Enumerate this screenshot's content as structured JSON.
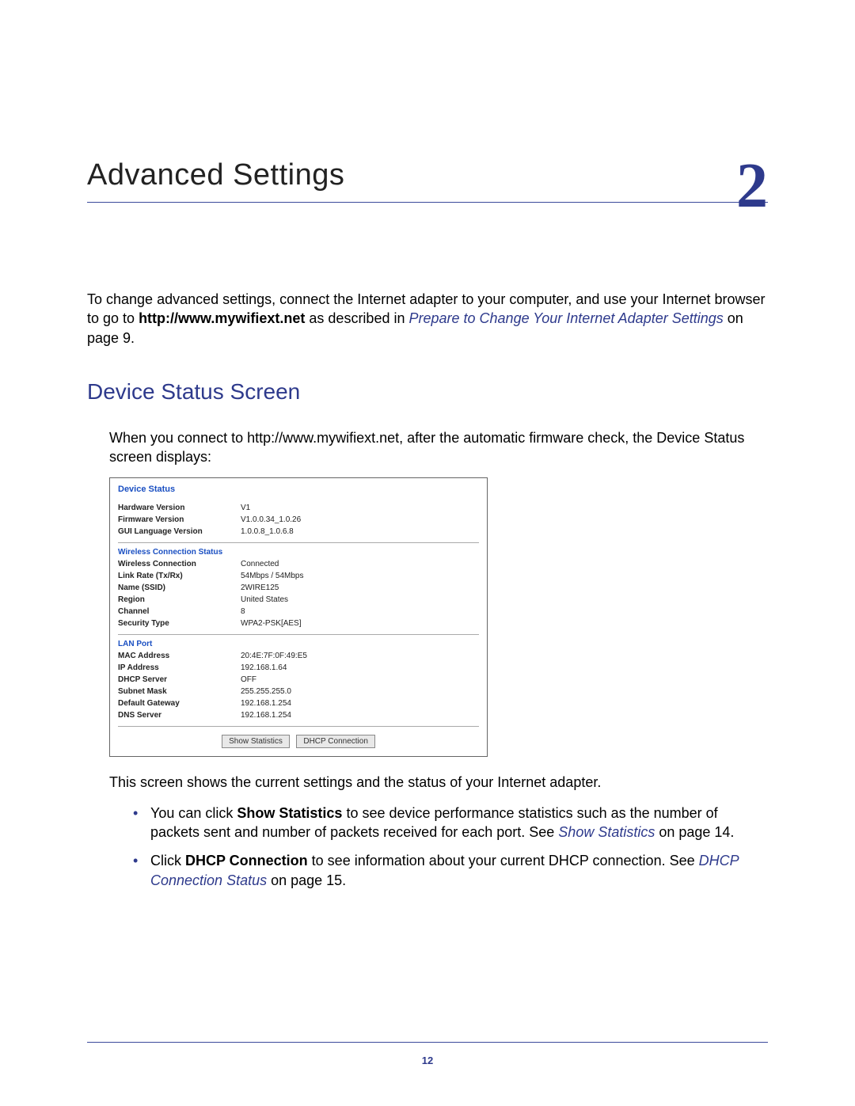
{
  "chapter": {
    "title": "Advanced Settings",
    "number": "2"
  },
  "intro": {
    "pre": "To change advanced settings, connect the Internet adapter to your computer, and use your Internet browser to go to ",
    "bold_url": "http://www.mywifiext.net",
    "mid": " as described in ",
    "link": "Prepare to Change Your Internet Adapter Settings",
    "post": " on page 9."
  },
  "section_heading": "Device Status Screen",
  "para_connect": "When you connect to http://www.mywifiext.net, after the automatic firmware check, the Device Status screen displays:",
  "device_status": {
    "title": "Device Status",
    "general": [
      {
        "label": "Hardware Version",
        "value": "V1"
      },
      {
        "label": "Firmware Version",
        "value": "V1.0.0.34_1.0.26"
      },
      {
        "label": "GUI Language Version",
        "value": "1.0.0.8_1.0.6.8"
      }
    ],
    "wireless_title": "Wireless Connection Status",
    "wireless": [
      {
        "label": "Wireless Connection",
        "value": "Connected"
      },
      {
        "label": "Link Rate (Tx/Rx)",
        "value": "54Mbps / 54Mbps"
      },
      {
        "label": "Name (SSID)",
        "value": "2WIRE125"
      },
      {
        "label": "Region",
        "value": "United States"
      },
      {
        "label": "Channel",
        "value": "8"
      },
      {
        "label": "Security Type",
        "value": "WPA2-PSK[AES]"
      }
    ],
    "lan_title": "LAN Port",
    "lan": [
      {
        "label": "MAC Address",
        "value": "20:4E:7F:0F:49:E5"
      },
      {
        "label": "IP Address",
        "value": "192.168.1.64"
      },
      {
        "label": "DHCP Server",
        "value": "OFF"
      },
      {
        "label": "Subnet Mask",
        "value": "255.255.255.0"
      },
      {
        "label": "Default Gateway",
        "value": "192.168.1.254"
      },
      {
        "label": "DNS Server",
        "value": "192.168.1.254"
      }
    ],
    "buttons": {
      "show_stats": "Show Statistics",
      "dhcp_conn": "DHCP Connection"
    }
  },
  "para_after": "This screen shows the current settings and the status of your Internet adapter.",
  "bullets": [
    {
      "pre": "You can click ",
      "bold": "Show Statistics",
      "mid": " to see device performance statistics such as the number of packets sent and number of packets received for each port. See ",
      "link": "Show Statistics",
      "post": " on page 14."
    },
    {
      "pre": "Click ",
      "bold": "DHCP Connection",
      "mid": " to see information about your current DHCP connection. See ",
      "link": "DHCP Connection Status",
      "post": " on page 15."
    }
  ],
  "page_number": "12"
}
